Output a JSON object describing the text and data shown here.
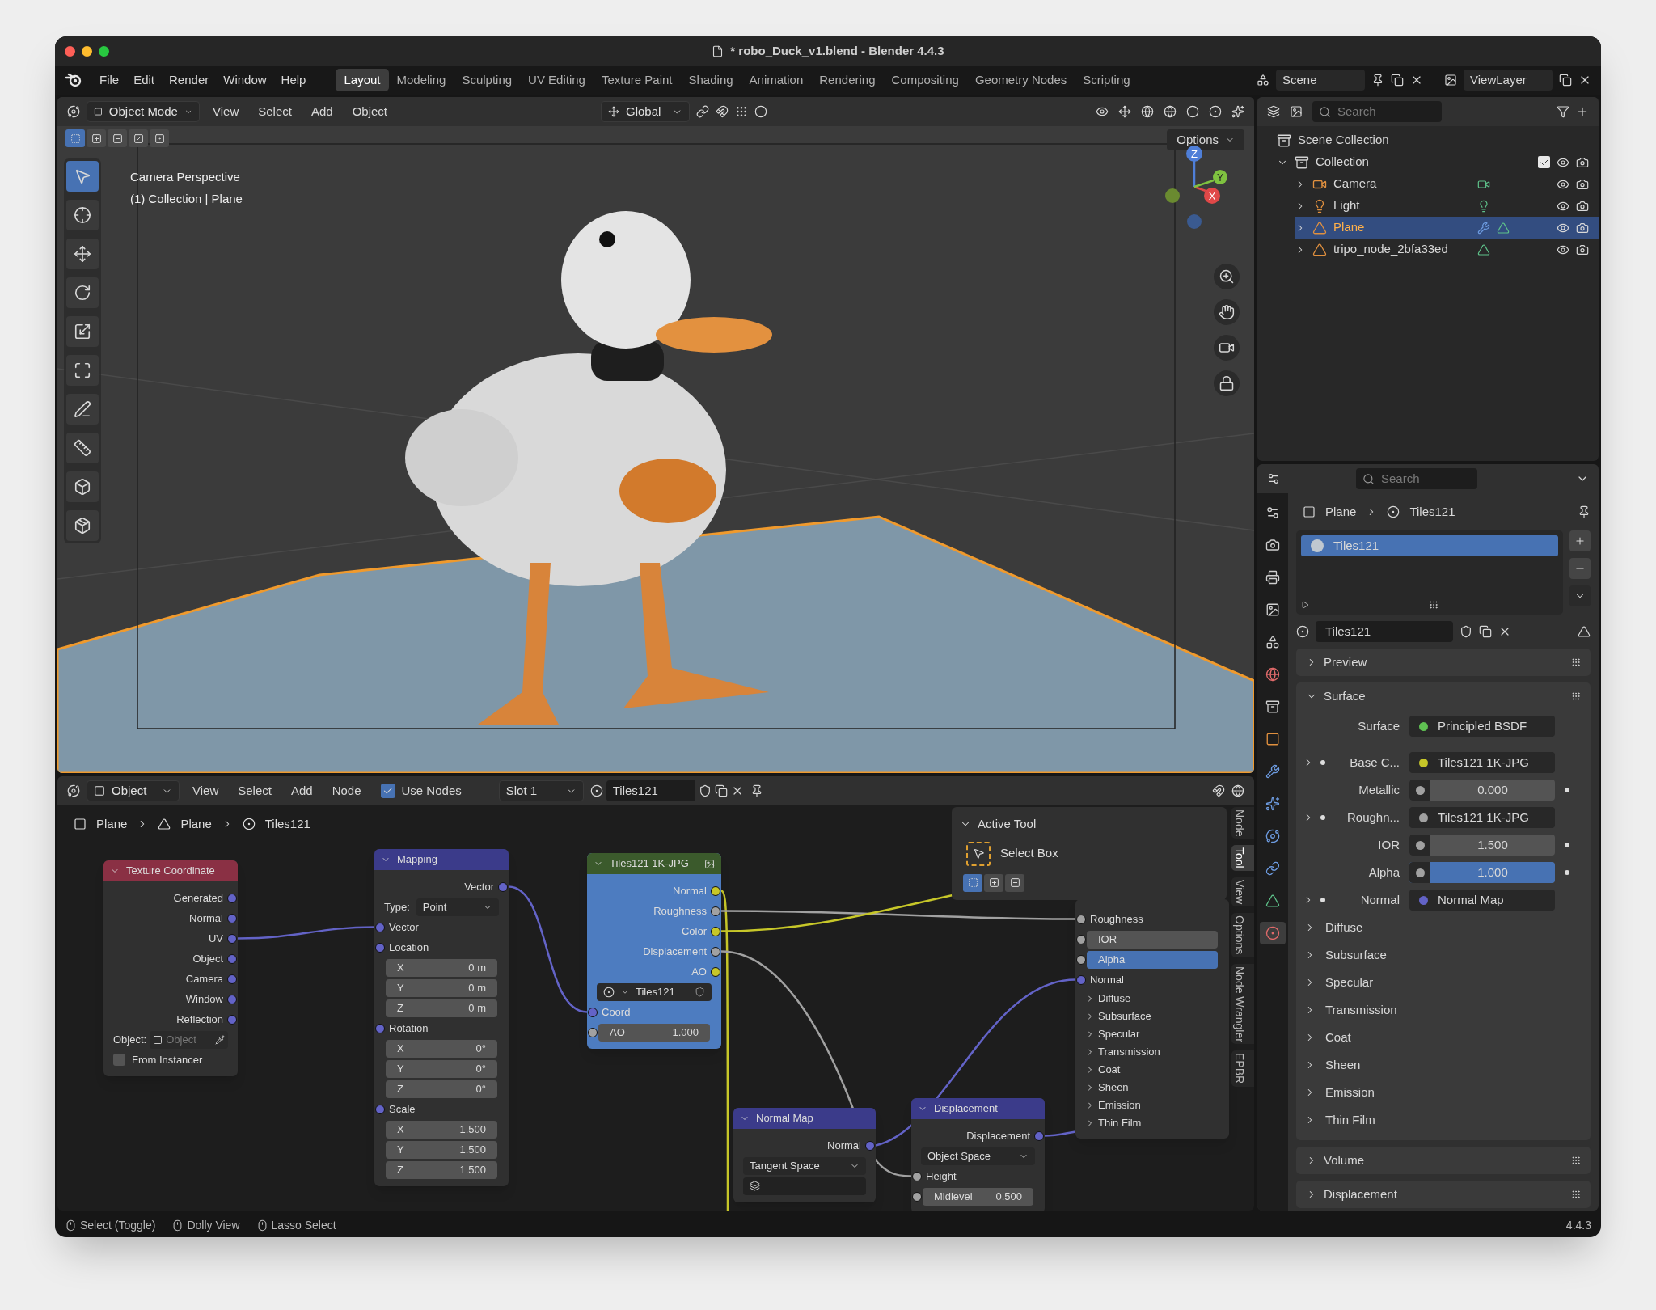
{
  "window": {
    "title": "* robo_Duck_v1.blend - Blender 4.4.3"
  },
  "menu": [
    "File",
    "Edit",
    "Render",
    "Window",
    "Help"
  ],
  "workspaces": [
    {
      "label": "Layout",
      "selected": true
    },
    {
      "label": "Modeling",
      "selected": false
    },
    {
      "label": "Sculpting",
      "selected": false
    },
    {
      "label": "UV Editing",
      "selected": false
    },
    {
      "label": "Texture Paint",
      "selected": false
    },
    {
      "label": "Shading",
      "selected": false
    },
    {
      "label": "Animation",
      "selected": false
    },
    {
      "label": "Rendering",
      "selected": false
    },
    {
      "label": "Compositing",
      "selected": false
    },
    {
      "label": "Geometry Nodes",
      "selected": false
    },
    {
      "label": "Scripting",
      "selected": false
    }
  ],
  "scene": "Scene",
  "view_layer": "ViewLayer",
  "viewport": {
    "mode": "Object Mode",
    "menu": [
      "View",
      "Select",
      "Add",
      "Object"
    ],
    "orientation": "Global",
    "options": "Options",
    "camera_label": "Camera Perspective",
    "context_label": "(1) Collection | Plane",
    "axes": [
      "Z",
      "X",
      "Y"
    ],
    "select_modes": [
      {
        "kind": "new",
        "selected": true
      },
      {
        "kind": "extend",
        "selected": false
      },
      {
        "kind": "subtract",
        "selected": false
      },
      {
        "kind": "invert",
        "selected": false
      },
      {
        "kind": "intersect",
        "selected": false
      }
    ],
    "tools": [
      {
        "kind": "select",
        "selected": true
      },
      {
        "kind": "cursor",
        "selected": false
      },
      {
        "kind": "move",
        "selected": false
      },
      {
        "kind": "rotate",
        "selected": false
      },
      {
        "kind": "scale",
        "selected": false
      },
      {
        "kind": "transform",
        "selected": false
      },
      {
        "kind": "annotate",
        "selected": false
      },
      {
        "kind": "measure",
        "selected": false
      },
      {
        "kind": "add_cube",
        "selected": false
      },
      {
        "kind": "add_object",
        "selected": false
      }
    ]
  },
  "outliner": {
    "search": {
      "placeholder": "Search"
    },
    "root": "Scene Collection",
    "collections": [
      {
        "label": "Collection",
        "expanded": true,
        "checked": true,
        "children": [
          {
            "label": "Camera",
            "kind": "camera",
            "expanded": false,
            "selected": false
          },
          {
            "label": "Light",
            "kind": "light",
            "expanded": false,
            "selected": false
          },
          {
            "label": "Plane",
            "kind": "mesh_modified",
            "expanded": false,
            "selected": true
          },
          {
            "label": "tripo_node_2bfa33ed",
            "kind": "mesh",
            "expanded": false,
            "selected": false
          }
        ]
      }
    ]
  },
  "properties": {
    "search": {
      "placeholder": "Search"
    },
    "tabs": [
      {
        "kind": "tool",
        "selected": false
      },
      {
        "kind": "render",
        "selected": false
      },
      {
        "kind": "output",
        "selected": false
      },
      {
        "kind": "view_layer",
        "selected": false
      },
      {
        "kind": "scene",
        "selected": false
      },
      {
        "kind": "world",
        "selected": false
      },
      {
        "kind": "collection",
        "selected": false
      },
      {
        "kind": "object",
        "selected": false
      },
      {
        "kind": "modifiers",
        "selected": false
      },
      {
        "kind": "particles",
        "selected": false
      },
      {
        "kind": "physics",
        "selected": false
      },
      {
        "kind": "constraints",
        "selected": false
      },
      {
        "kind": "data",
        "selected": false
      },
      {
        "kind": "material",
        "selected": true
      }
    ],
    "breadcrumb": [
      "Plane",
      "Tiles121"
    ],
    "slots": [
      {
        "label": "Tiles121",
        "selected": true
      }
    ],
    "material": "Tiles121",
    "panels": [
      {
        "label": "Preview",
        "expanded": false
      },
      {
        "label": "Surface",
        "expanded": true,
        "surface": {
          "label": "Surface",
          "value": "Principled BSDF",
          "color": "#5fc052"
        },
        "inputs": [
          {
            "kind": "link",
            "label": "Base C...",
            "value": "Tiles121 1K-JPG",
            "color": "#c7c729"
          },
          {
            "kind": "number",
            "label": "Metallic",
            "value": "0.000"
          },
          {
            "kind": "link",
            "label": "Roughn...",
            "value": "Tiles121 1K-JPG",
            "color": "#a1a1a1"
          },
          {
            "kind": "number",
            "label": "IOR",
            "value": "1.500"
          },
          {
            "kind": "number",
            "label": "Alpha",
            "value": "1.000",
            "level": 1
          },
          {
            "kind": "link",
            "label": "Normal",
            "value": "Normal Map",
            "color": "#6363c7"
          }
        ],
        "subpanels": [
          "Diffuse",
          "Subsurface",
          "Specular",
          "Transmission",
          "Coat",
          "Sheen",
          "Emission",
          "Thin Film"
        ]
      },
      {
        "label": "Volume",
        "expanded": false
      },
      {
        "label": "Displacement",
        "expanded": false
      }
    ]
  },
  "node_editor": {
    "mode": "Object",
    "menu": [
      "View",
      "Select",
      "Add",
      "Node"
    ],
    "use_nodes": {
      "label": "Use Nodes",
      "checked": true
    },
    "slot": "Slot 1",
    "material": "Tiles121",
    "breadcrumb": [
      {
        "kind": "object",
        "label": "Plane"
      },
      {
        "kind": "mesh",
        "label": "Plane"
      },
      {
        "kind": "material",
        "label": "Tiles121"
      }
    ],
    "nodes": [
      {
        "kind": "texture",
        "title": "Texture Coordinate",
        "rows": [
          {
            "kind": "output",
            "label": "Generated"
          },
          {
            "kind": "output",
            "label": "Normal"
          },
          {
            "kind": "output",
            "label": "UV"
          },
          {
            "kind": "output",
            "label": "Object"
          },
          {
            "kind": "output",
            "label": "Camera"
          },
          {
            "kind": "output",
            "label": "Window"
          },
          {
            "kind": "output",
            "label": "Reflection"
          },
          {
            "kind": "object",
            "label": "Object:",
            "placeholder": "Object"
          },
          {
            "kind": "checkbox",
            "label": "From Instancer",
            "checked": false
          }
        ]
      },
      {
        "kind": "vector",
        "title": "Mapping",
        "rows": [
          {
            "kind": "output",
            "label": "Vector"
          },
          {
            "kind": "dropdown",
            "label": "Type:",
            "value": "Point"
          },
          {
            "kind": "input",
            "label": "Vector"
          },
          {
            "kind": "input",
            "label": "Location"
          },
          {
            "kind": "field",
            "label": "X",
            "value": "0 m"
          },
          {
            "kind": "field",
            "label": "Y",
            "value": "0 m"
          },
          {
            "kind": "field",
            "label": "Z",
            "value": "0 m"
          },
          {
            "kind": "input",
            "label": "Rotation"
          },
          {
            "kind": "field",
            "label": "X",
            "value": "0°"
          },
          {
            "kind": "field",
            "label": "Y",
            "value": "0°"
          },
          {
            "kind": "field",
            "label": "Z",
            "value": "0°"
          },
          {
            "kind": "input",
            "label": "Scale"
          },
          {
            "kind": "field",
            "label": "X",
            "value": "1.500"
          },
          {
            "kind": "field",
            "label": "Y",
            "value": "1.500"
          },
          {
            "kind": "field",
            "label": "Z",
            "value": "1.500"
          }
        ]
      },
      {
        "kind": "image",
        "title": "Tiles121 1K-JPG",
        "color": "#4d7cc0",
        "rows": [
          {
            "kind": "output",
            "label": "Normal",
            "color": "#c7c729"
          },
          {
            "kind": "output",
            "label": "Roughness",
            "color": "#a1a1a1"
          },
          {
            "kind": "output",
            "label": "Color",
            "color": "#c7c729"
          },
          {
            "kind": "output",
            "label": "Displacement",
            "color": "#a1a1a1"
          },
          {
            "kind": "output",
            "label": "AO",
            "color": "#c7c729"
          },
          {
            "kind": "image",
            "value": "Tiles121"
          },
          {
            "kind": "input",
            "label": "Coord"
          },
          {
            "kind": "field",
            "label": "AO",
            "value": "1.000",
            "color": "#a1a1a1"
          }
        ]
      },
      {
        "kind": "vector",
        "title": "Normal Map",
        "rows": [
          {
            "kind": "output",
            "label": "Normal"
          },
          {
            "kind": "dropdown",
            "value": "Tangent Space"
          },
          {
            "kind": "uv_map"
          }
        ]
      },
      {
        "kind": "vector",
        "title": "Displacement",
        "rows": [
          {
            "kind": "output",
            "label": "Displacement"
          },
          {
            "kind": "dropdown",
            "value": "Object Space"
          },
          {
            "kind": "input",
            "label": "Height",
            "color": "#a1a1a1"
          },
          {
            "kind": "field",
            "label": "Midlevel",
            "value": "0.500",
            "color": "#a1a1a1"
          }
        ]
      },
      {
        "rows": [
          {
            "kind": "input",
            "label": "Roughness",
            "color": "#a1a1a1"
          },
          {
            "kind": "field",
            "label": "IOR",
            "color": "#a1a1a1"
          },
          {
            "kind": "field",
            "label": "Alpha",
            "color": "#a1a1a1",
            "level": 1
          },
          {
            "kind": "input",
            "label": "Normal"
          },
          {
            "kind": "panel",
            "label": "Diffuse"
          },
          {
            "kind": "panel",
            "label": "Subsurface"
          },
          {
            "kind": "panel",
            "label": "Specular"
          },
          {
            "kind": "panel",
            "label": "Transmission"
          },
          {
            "kind": "panel",
            "label": "Coat"
          },
          {
            "kind": "panel",
            "label": "Sheen"
          },
          {
            "kind": "panel",
            "label": "Emission"
          },
          {
            "kind": "panel",
            "label": "Thin Film"
          }
        ]
      }
    ],
    "active_tool": {
      "title": "Active Tool",
      "tool": "Select Box",
      "modes": [
        {
          "kind": "new",
          "selected": true
        },
        {
          "kind": "extend",
          "selected": false
        },
        {
          "kind": "subtract",
          "selected": false
        }
      ]
    },
    "sidebar_tabs": [
      {
        "label": "Node",
        "selected": false
      },
      {
        "label": "Tool",
        "selected": true
      },
      {
        "label": "View",
        "selected": false
      },
      {
        "label": "Options",
        "selected": false
      },
      {
        "label": "Node Wrangler",
        "selected": false
      },
      {
        "label": "EPBR",
        "selected": false
      }
    ]
  },
  "status_bar": {
    "hints": [
      "Select (Toggle)",
      "Dolly View",
      "Lasso Select"
    ],
    "version": "4.4.3"
  }
}
